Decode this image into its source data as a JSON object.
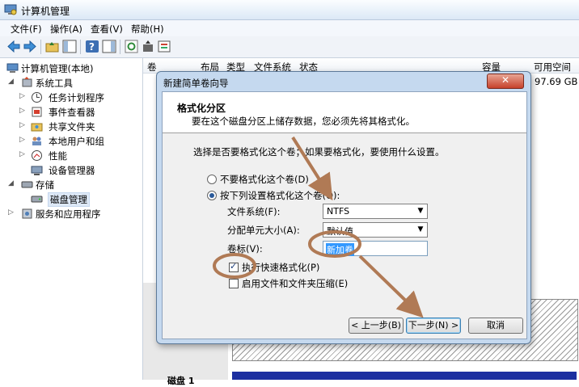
{
  "window": {
    "title": "计算机管理"
  },
  "menu": [
    "文件(F)",
    "操作(A)",
    "查看(V)",
    "帮助(H)"
  ],
  "tree": {
    "root": "计算机管理(本地)",
    "system_tools": "系统工具",
    "task_scheduler": "任务计划程序",
    "event_viewer": "事件查看器",
    "shared_folders": "共享文件夹",
    "local_users": "本地用户和组",
    "performance": "性能",
    "device_manager": "设备管理器",
    "storage": "存储",
    "disk_management": "磁盘管理",
    "services_apps": "服务和应用程序"
  },
  "columns": [
    "卷",
    "布局",
    "类型",
    "文件系统",
    "状态",
    "容量",
    "可用空间"
  ],
  "list": {
    "free_space": "97.69 GB"
  },
  "disk_label": "磁盘 1",
  "dialog": {
    "title": "新建简单卷向导",
    "header_title": "格式化分区",
    "header_sub": "要在这个磁盘分区上储存数据，您必须先将其格式化。",
    "prompt": "选择是否要格式化这个卷；如果要格式化，要使用什么设置。",
    "opt_no_format": "不要格式化这个卷(D)",
    "opt_format": "按下列设置格式化这个卷(O):",
    "fs_label": "文件系统(F):",
    "fs_value": "NTFS",
    "alloc_label": "分配单元大小(A):",
    "alloc_value": "默认值",
    "vol_label": "卷标(V):",
    "vol_value": "新加卷",
    "quick_format": "执行快速格式化(P)",
    "compress": "启用文件和文件夹压缩(E)",
    "back_btn": "< 上一步(B)",
    "next_btn": "下一步(N) >",
    "cancel_btn": "取消"
  },
  "colors": {
    "annotation": "#b07a55",
    "dialog_frame": "#c5d9ef",
    "selection": "#3399ff"
  }
}
